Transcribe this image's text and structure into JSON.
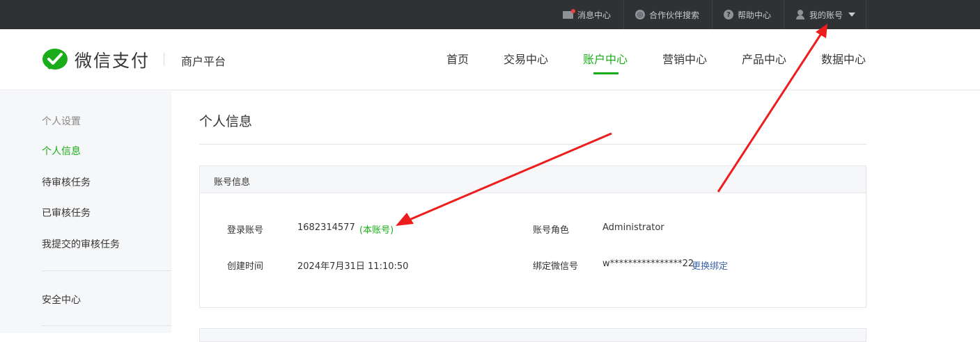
{
  "topbar": {
    "messages": "消息中心",
    "partner_search": "合作伙伴搜索",
    "help": "帮助中心",
    "my_account": "我的账号"
  },
  "header": {
    "brand": "微信支付",
    "platform": "商户平台",
    "nav": [
      "首页",
      "交易中心",
      "账户中心",
      "营销中心",
      "产品中心",
      "数据中心"
    ],
    "active_nav": "账户中心"
  },
  "sidebar": {
    "group_title": "个人设置",
    "items": [
      "个人信息",
      "待审核任务",
      "已审核任务",
      "我提交的审核任务"
    ],
    "security": "安全中心"
  },
  "main": {
    "page_title": "个人信息",
    "panel_title": "账号信息",
    "login_account_label": "登录账号",
    "login_account_value": "1682314577",
    "this_account_tag": "(本账号)",
    "created_label": "创建时间",
    "created_value": "2024年7月31日 11:10:50",
    "role_label": "账号角色",
    "role_value": "Administrator",
    "wechat_label": "绑定微信号",
    "wechat_value": "w****************22",
    "change_binding": "更换绑定"
  },
  "colors": {
    "accent": "#1aad19",
    "topbar_bg": "#2f3135",
    "link": "#3e64a8",
    "annotation_arrow": "#ee1c1c"
  }
}
